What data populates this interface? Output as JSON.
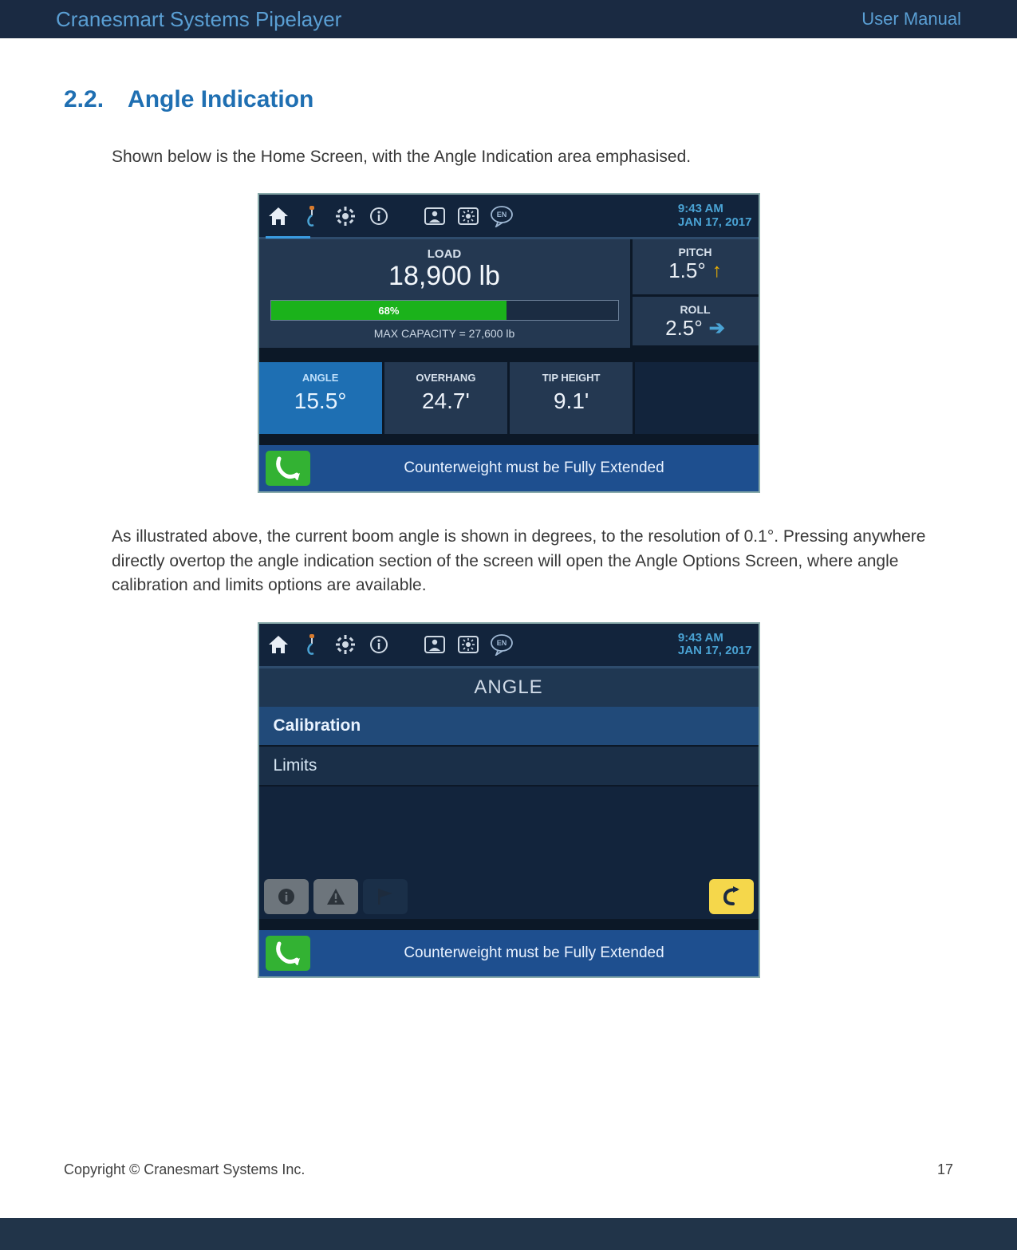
{
  "header": {
    "title": "Cranesmart Systems Pipelayer",
    "right": "User Manual"
  },
  "section": {
    "heading": "2.2. Angle Indication",
    "intro": "Shown below is the Home Screen, with the Angle Indication area emphasised.",
    "para2": "As illustrated above, the current boom angle is shown in degrees, to the resolution of 0.1°. Pressing anywhere directly overtop the angle indication section of the screen will open the Angle Options Screen, where angle calibration and limits options are available."
  },
  "screenshot1": {
    "datetime": {
      "time": "9:43 AM",
      "date": "JAN 17, 2017"
    },
    "lang": "EN",
    "load": {
      "label": "LOAD",
      "value": "18,900 lb"
    },
    "progress": {
      "percent_label": "68%",
      "percent": 68,
      "max": "MAX CAPACITY = 27,600 lb"
    },
    "pitch": {
      "label": "PITCH",
      "value": "1.5°"
    },
    "roll": {
      "label": "ROLL",
      "value": "2.5°"
    },
    "tiles": {
      "angle": {
        "label": "ANGLE",
        "value": "15.5°"
      },
      "overhang": {
        "label": "OVERHANG",
        "value": "24.7'"
      },
      "tipheight": {
        "label": "TIP HEIGHT",
        "value": "9.1'"
      }
    },
    "message": "Counterweight must be Fully Extended"
  },
  "screenshot2": {
    "datetime": {
      "time": "9:43 AM",
      "date": "JAN 17, 2017"
    },
    "lang": "EN",
    "title": "ANGLE",
    "items": {
      "calibration": "Calibration",
      "limits": "Limits"
    },
    "message": "Counterweight must be Fully Extended"
  },
  "footer": {
    "copyright": "Copyright © Cranesmart Systems Inc.",
    "page": "17"
  }
}
